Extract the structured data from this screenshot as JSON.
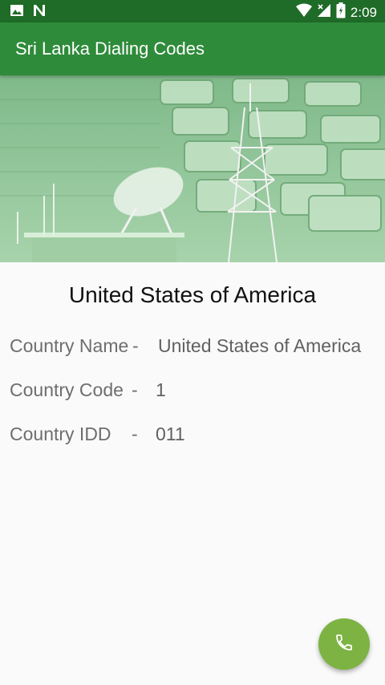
{
  "status_bar": {
    "time": "2:09",
    "icons": [
      "image-icon",
      "n-notification-icon",
      "wifi-icon",
      "signal-icon",
      "battery-icon"
    ]
  },
  "app_bar": {
    "title": "Sri Lanka Dialing Codes"
  },
  "banner": {
    "image": "telecom-tower-keypad-banner"
  },
  "detail": {
    "title": "United States of America",
    "rows": [
      {
        "label": "Country Name",
        "separator": "-",
        "value": "United States of America"
      },
      {
        "label": "Country Code",
        "separator": "-",
        "value": "1"
      },
      {
        "label": "Country IDD",
        "separator": "-",
        "value": "011"
      }
    ]
  },
  "fab": {
    "icon": "phone-icon"
  },
  "colors": {
    "status_bar": "#1f6b28",
    "app_bar": "#2e8b3a",
    "fab": "#7cb342",
    "background": "#fafafa"
  }
}
